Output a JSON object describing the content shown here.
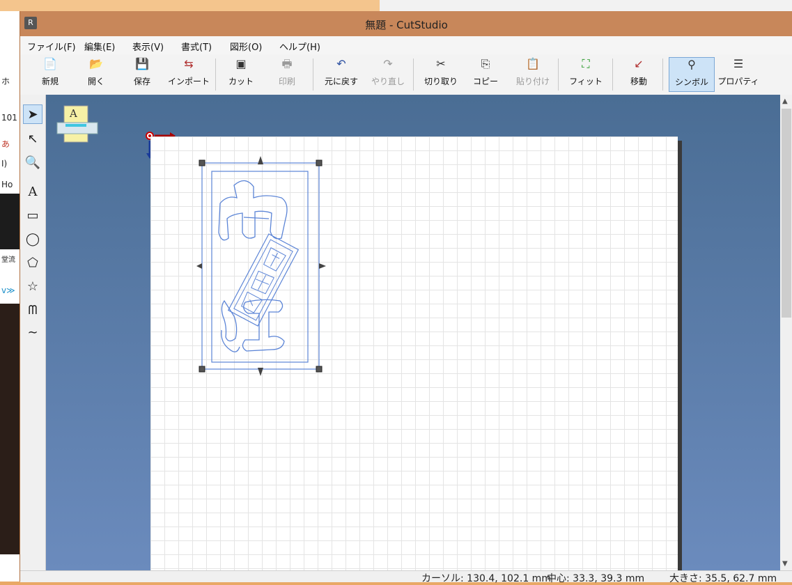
{
  "window": {
    "title": "無題 - CutStudio",
    "icon_label": "R"
  },
  "menu": [
    "ファイル(F)",
    "編集(E)",
    "表示(V)",
    "書式(T)",
    "図形(O)",
    "ヘルプ(H)"
  ],
  "toolbar": {
    "new": "新規",
    "open": "開く",
    "save": "保存",
    "import": "インポート",
    "cut_out": "カット",
    "print": "印刷",
    "undo": "元に戻す",
    "redo": "やり直し",
    "cut": "切り取り",
    "copy": "コピー",
    "paste": "貼り付け",
    "fit": "フィット",
    "move": "移動",
    "symbol": "シンボル",
    "property": "プロパティ"
  },
  "icons": {
    "new": "📄",
    "open": "📂",
    "save": "💾",
    "import": "⇆",
    "cut_out": "▣",
    "print": "🖶",
    "undo": "↶",
    "redo": "↷",
    "cut": "✂",
    "copy": "⎘",
    "paste": "📋",
    "fit": "⛶",
    "move": "↙",
    "symbol": "⚲",
    "property": "☰",
    "tool_select": "➤",
    "tool_node": "↖",
    "tool_zoom": "🔍",
    "tool_text": "A",
    "tool_rect": "▭",
    "tool_ellipse": "◯",
    "tool_polygon": "⬠",
    "tool_star": "☆",
    "tool_polyline": "ᗰ",
    "tool_curve": "∼",
    "media_text": "A"
  },
  "status": {
    "cursor": "カーソル: 130.4, 102.1 mm",
    "center": "中心: 33.3, 39.3 mm",
    "size": "大きさ: 35.5, 62.7 mm"
  },
  "background": {
    "left_texts": [
      "ホ",
      "101",
      "あ",
      "I)",
      "Ho",
      "堂流",
      "v≫"
    ]
  },
  "colors": {
    "outline": "#5b84d6",
    "title_bar": "#c8875a",
    "accent": "#cde3f7"
  }
}
